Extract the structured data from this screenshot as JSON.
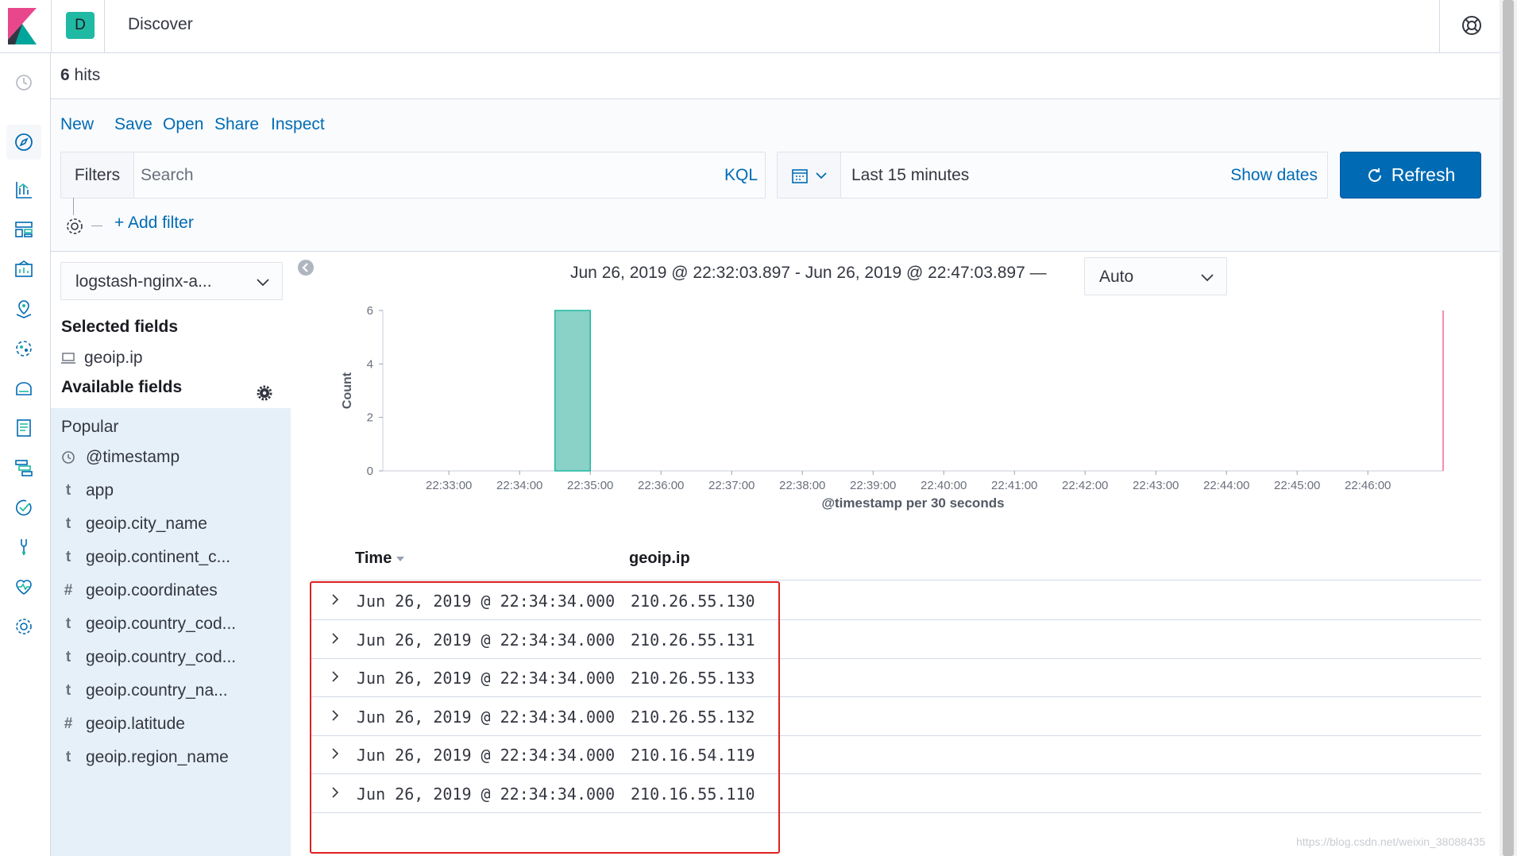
{
  "header": {
    "space_initial": "D",
    "title": "Discover"
  },
  "hits": {
    "count": "6",
    "label": "hits"
  },
  "menu": [
    "New",
    "Save",
    "Open",
    "Share",
    "Inspect"
  ],
  "query": {
    "filters_label": "Filters",
    "search_placeholder": "Search",
    "language": "KQL"
  },
  "datepicker": {
    "range": "Last 15 minutes",
    "show_dates": "Show dates"
  },
  "refresh_label": "Refresh",
  "add_filter": "+ Add filter",
  "sidebar": {
    "index_pattern": "logstash-nginx-a...",
    "selected_heading": "Selected fields",
    "selected_fields": [
      {
        "name": "geoip.ip",
        "icon": "computer-icon"
      }
    ],
    "available_heading": "Available fields",
    "popular_label": "Popular",
    "fields": [
      {
        "type": "clock",
        "name": "@timestamp"
      },
      {
        "type": "t",
        "name": "app"
      },
      {
        "type": "t",
        "name": "geoip.city_name"
      },
      {
        "type": "t",
        "name": "geoip.continent_c..."
      },
      {
        "type": "#",
        "name": "geoip.coordinates"
      },
      {
        "type": "t",
        "name": "geoip.country_cod..."
      },
      {
        "type": "t",
        "name": "geoip.country_cod..."
      },
      {
        "type": "t",
        "name": "geoip.country_na..."
      },
      {
        "type": "#",
        "name": "geoip.latitude"
      },
      {
        "type": "t",
        "name": "geoip.region_name"
      }
    ]
  },
  "chart_header": {
    "range_text": "Jun 26, 2019 @ 22:32:03.897 - Jun 26, 2019 @ 22:47:03.897 —",
    "interval": "Auto"
  },
  "chart_data": {
    "type": "bar",
    "ylabel": "Count",
    "xlabel": "@timestamp per 30 seconds",
    "ylim": [
      0,
      6
    ],
    "yticks": [
      0,
      2,
      4,
      6
    ],
    "xticks": [
      "22:33:00",
      "22:34:00",
      "22:35:00",
      "22:36:00",
      "22:37:00",
      "22:38:00",
      "22:39:00",
      "22:40:00",
      "22:41:00",
      "22:42:00",
      "22:43:00",
      "22:44:00",
      "22:45:00",
      "22:46:00"
    ],
    "bars": [
      {
        "start": "22:34:30",
        "end": "22:35:00",
        "value": 6
      }
    ],
    "bar_color": "#8ad1c7"
  },
  "table": {
    "columns": [
      "Time",
      "geoip.ip"
    ],
    "rows": [
      {
        "time": "Jun 26, 2019 @ 22:34:34.000",
        "ip": "210.26.55.130"
      },
      {
        "time": "Jun 26, 2019 @ 22:34:34.000",
        "ip": "210.26.55.131"
      },
      {
        "time": "Jun 26, 2019 @ 22:34:34.000",
        "ip": "210.26.55.133"
      },
      {
        "time": "Jun 26, 2019 @ 22:34:34.000",
        "ip": "210.26.55.132"
      },
      {
        "time": "Jun 26, 2019 @ 22:34:34.000",
        "ip": "210.16.54.119"
      },
      {
        "time": "Jun 26, 2019 @ 22:34:34.000",
        "ip": "210.16.55.110"
      }
    ]
  },
  "watermark": "https://blog.csdn.net/weixin_38088435",
  "colors": {
    "accent": "#006bb4",
    "badge": "#20b9a3",
    "highlight": "#e02020"
  }
}
